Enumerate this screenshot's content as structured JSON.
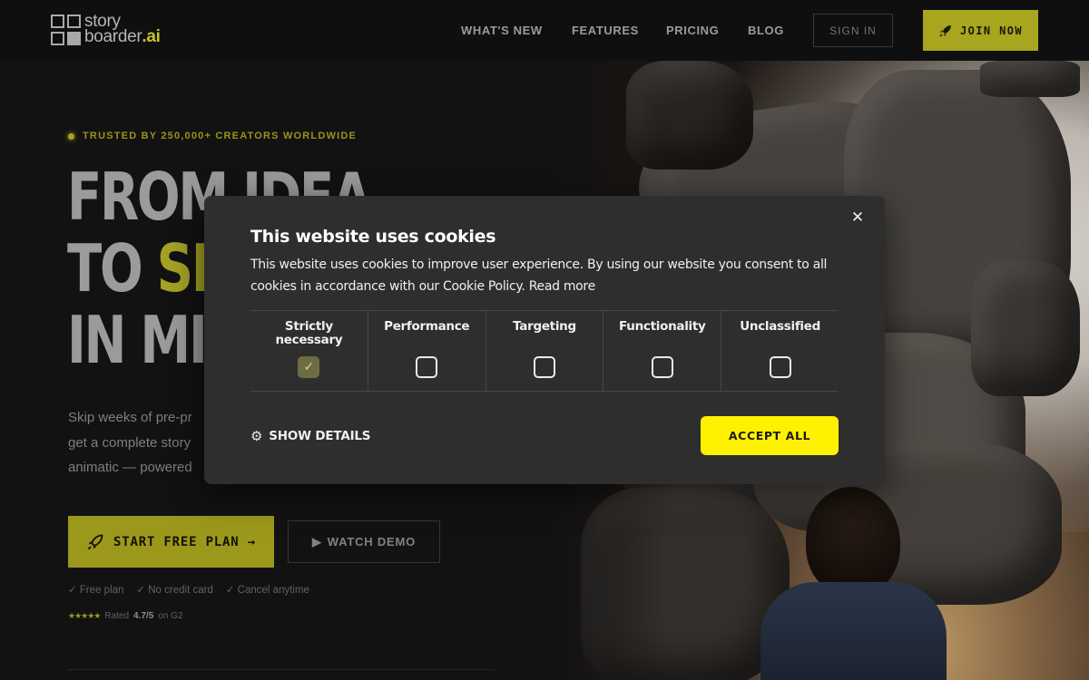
{
  "brand": {
    "logo_word1": "story",
    "logo_word2": "boarder",
    "logo_ai": ".ai"
  },
  "nav": {
    "items": [
      "WHAT'S NEW",
      "FEATURES",
      "PRICING",
      "BLOG"
    ],
    "sign_in": "SIGN IN",
    "join_now": "JOIN NOW"
  },
  "hero": {
    "trusted": "TRUSTED BY 250,000+ CREATORS WORLDWIDE",
    "headline_line1": "FROM IDEA",
    "headline_line2_a": "TO ",
    "headline_line2_b": "SH",
    "headline_line3": "IN MI",
    "sub_line1": "Skip weeks of pre-pr",
    "sub_line2": "get a complete story",
    "sub_line3": "animatic — powered",
    "start_free": "START FREE PLAN →",
    "watch_demo": "WATCH DEMO",
    "perks": [
      "✓ Free plan",
      "✓ No credit card",
      "✓ Cancel anytime"
    ],
    "rating_stars": "★★★★★",
    "rating_prefix": "Rated",
    "rating_value": "4.7/5",
    "rating_suffix": "on G2"
  },
  "cookie": {
    "title": "This website uses cookies",
    "description": "This website uses cookies to improve user experience. By using our website you consent to all cookies in accordance with our Cookie Policy.",
    "read_more": "Read more",
    "categories": [
      {
        "label": "Strictly necessary",
        "checked": true
      },
      {
        "label": "Performance",
        "checked": false
      },
      {
        "label": "Targeting",
        "checked": false
      },
      {
        "label": "Functionality",
        "checked": false
      },
      {
        "label": "Unclassified",
        "checked": false
      }
    ],
    "show_details": "SHOW DETAILS",
    "accept_all": "ACCEPT ALL",
    "close_symbol": "✕"
  },
  "colors": {
    "accent": "#b7b422",
    "accept_button": "#fff200",
    "modal_bg": "#2e2e2e"
  },
  "icons": [
    "logo-grid-icon",
    "rocket-icon",
    "play-icon",
    "gear-icon",
    "close-icon",
    "check-icon"
  ]
}
